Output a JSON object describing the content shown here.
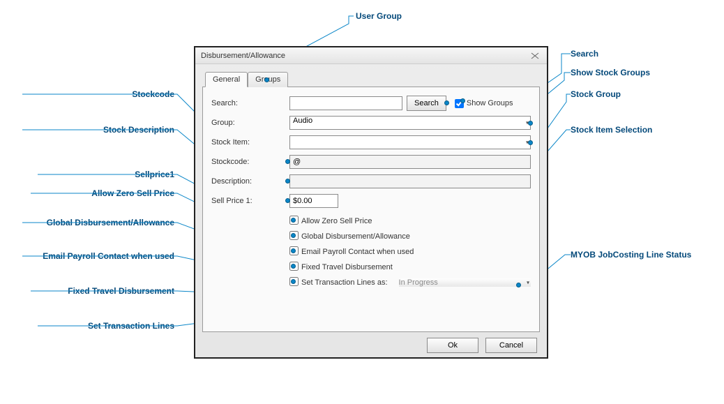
{
  "window": {
    "title": "Disbursement/Allowance"
  },
  "tabs": {
    "general": "General",
    "groups": "Groups"
  },
  "labels": {
    "search": "Search:",
    "group": "Group:",
    "stock_item": "Stock Item:",
    "stockcode": "Stockcode:",
    "description": "Description:",
    "sell_price": "Sell Price 1:"
  },
  "buttons": {
    "search": "Search",
    "ok": "Ok",
    "cancel": "Cancel"
  },
  "checks": {
    "show_groups": "Show Groups",
    "allow_zero": "Allow Zero Sell Price",
    "global_disb": "Global Disbursement/Allowance",
    "email_payroll": "Email Payroll Contact when used",
    "fixed_travel": "Fixed Travel Disbursement",
    "set_txn_lines": "Set Transaction Lines as:"
  },
  "fields": {
    "search": "",
    "group": "Audio",
    "stock_item": "",
    "stockcode": "@",
    "description": "",
    "sell_price": "$0.00",
    "txn_status": "In Progress"
  },
  "callouts": {
    "user_group": "User Group",
    "stockcode": "Stockcode",
    "stock_description": "Stock Description",
    "sellprice1": "Sellprice1",
    "allow_zero": "Allow Zero Sell Price",
    "global_disb": "Global Disbursement/Allowance",
    "email_payroll": "Email Payroll Contact when used",
    "fixed_travel": "Fixed Travel Disbursement",
    "set_txn_lines": "Set Transaction Lines",
    "search": "Search",
    "show_stock_groups": "Show Stock Groups",
    "stock_group": "Stock Group",
    "stock_item_selection": "Stock Item Selection",
    "myob_status": "MYOB JobCosting Line Status"
  }
}
